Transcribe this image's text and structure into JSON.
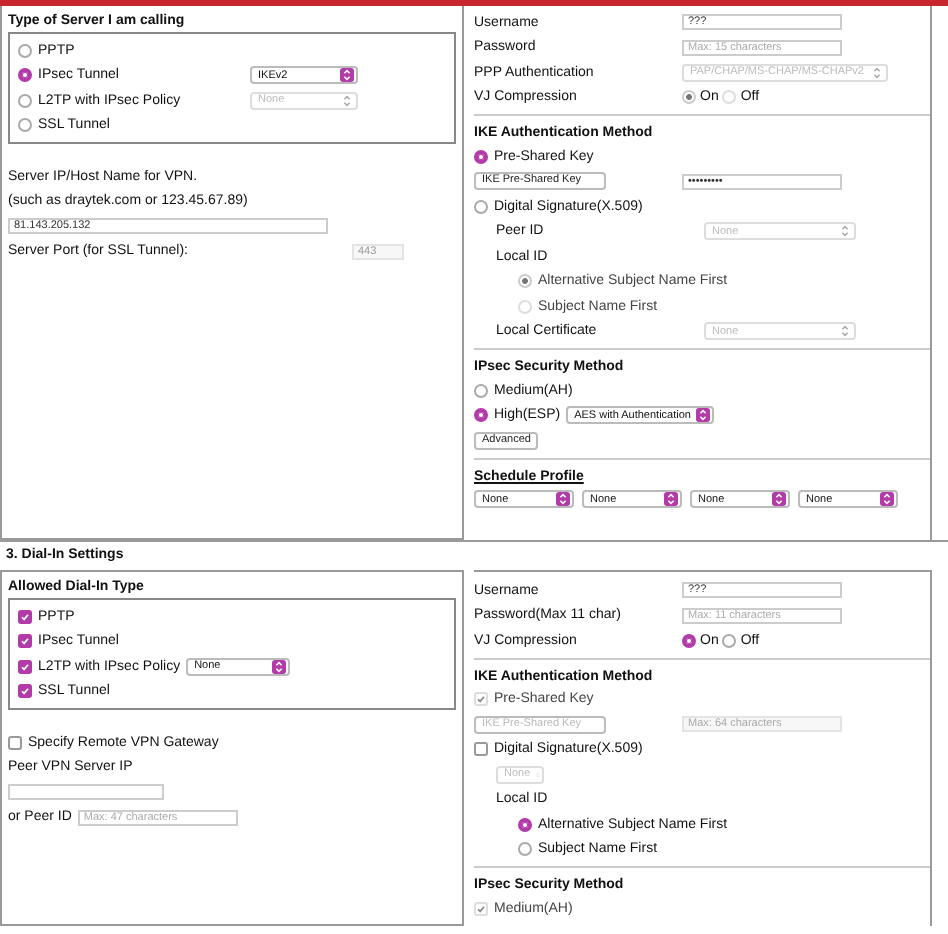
{
  "dial_out": {
    "server_type": {
      "title": "Type of Server I am calling",
      "items": [
        {
          "kind": "radio",
          "label": "PPTP",
          "selected": false
        },
        {
          "kind": "radio",
          "label": "IPsec Tunnel",
          "selected": true,
          "select": {
            "value": "IKEv2",
            "disabled": false
          }
        },
        {
          "kind": "radio",
          "label": "L2TP with IPsec Policy",
          "selected": false,
          "select": {
            "value": "None",
            "disabled": true
          }
        },
        {
          "kind": "radio",
          "label": "SSL Tunnel",
          "selected": false
        }
      ]
    },
    "server_items": [
      {
        "kind": "text",
        "label": "Server IP/Host Name for VPN."
      },
      {
        "kind": "text",
        "label": "(such as draytek.com or 123.45.67.89)"
      },
      {
        "kind": "field",
        "value": "81.143.205.132"
      },
      {
        "kind": "field",
        "label": "Server Port (for SSL Tunnel):",
        "value": "443",
        "disabled": true
      }
    ],
    "sections": [
      {
        "items": [
          {
            "kind": "field",
            "label": "Username",
            "value": "???"
          },
          {
            "kind": "field",
            "label": "Password",
            "placeholder": "Max: 15 characters"
          },
          {
            "kind": "select",
            "label": "PPP Authentication",
            "value": "PAP/CHAP/MS-CHAP/MS-CHAPv2",
            "disabled": true
          },
          {
            "kind": "options",
            "label": "VJ Compression",
            "disabled": true,
            "options": [
              {
                "label": "On",
                "selected": true
              },
              {
                "label": "Off",
                "selected": false
              }
            ]
          }
        ]
      },
      {
        "title": "IKE Authentication Method",
        "items": [
          {
            "kind": "radio",
            "label": "Pre-Shared Key",
            "selected": true
          },
          {
            "kind": "key",
            "button": {
              "label": "IKE Pre-Shared Key",
              "disabled": false
            },
            "field": {
              "value": "•••••••••"
            }
          },
          {
            "kind": "radio",
            "label": "Digital Signature(X.509)",
            "selected": false,
            "children": [
              {
                "kind": "select",
                "label": "Peer ID",
                "value": "None",
                "disabled": true
              },
              {
                "kind": "text",
                "label": "Local ID",
                "children": [
                  {
                    "kind": "radio",
                    "label": "Alternative Subject Name First",
                    "selected": true,
                    "disabled": true
                  },
                  {
                    "kind": "radio",
                    "label": "Subject Name First",
                    "selected": false,
                    "disabled": true
                  }
                ]
              },
              {
                "kind": "select",
                "label": "Local Certificate",
                "value": "None",
                "disabled": true
              }
            ]
          }
        ]
      },
      {
        "title": "IPsec Security Method",
        "items": [
          {
            "kind": "radio",
            "label": "Medium(AH)",
            "selected": false
          },
          {
            "kind": "radio",
            "label": "High(ESP)",
            "selected": true,
            "select": {
              "value": "AES with Authentication",
              "disabled": false
            }
          },
          {
            "kind": "button",
            "label": "Advanced"
          }
        ]
      },
      {
        "title": "Schedule Profile",
        "link": true,
        "items": [
          {
            "kind": "selects",
            "selects": [
              {
                "value": "None"
              },
              {
                "value": "None"
              },
              {
                "value": "None"
              },
              {
                "value": "None"
              }
            ]
          }
        ]
      }
    ]
  },
  "dial_in": {
    "heading": "3. Dial-In Settings",
    "allowed": {
      "title": "Allowed Dial-In Type",
      "items": [
        {
          "kind": "checkbox",
          "label": "PPTP",
          "checked": true
        },
        {
          "kind": "checkbox",
          "label": "IPsec Tunnel",
          "checked": true
        },
        {
          "kind": "checkbox",
          "label": "L2TP with IPsec Policy",
          "checked": true,
          "select": {
            "value": "None",
            "disabled": false
          }
        },
        {
          "kind": "checkbox",
          "label": "SSL Tunnel",
          "checked": true
        }
      ]
    },
    "items": [
      {
        "kind": "checkbox",
        "label": "Specify Remote VPN Gateway",
        "checked": false
      },
      {
        "kind": "text",
        "label": "Peer VPN Server IP"
      },
      {
        "kind": "field"
      },
      {
        "kind": "inline-field",
        "label": "or Peer ID",
        "placeholder": "Max: 47 characters"
      }
    ],
    "sections": [
      {
        "items": [
          {
            "kind": "field",
            "label": "Username",
            "value": "???"
          },
          {
            "kind": "field",
            "label": "Password(Max 11 char)",
            "placeholder": "Max: 11 characters"
          },
          {
            "kind": "options",
            "label": "VJ Compression",
            "disabled": false,
            "options": [
              {
                "label": "On",
                "selected": true
              },
              {
                "label": "Off",
                "selected": false
              }
            ]
          }
        ]
      },
      {
        "title": "IKE Authentication Method",
        "items": [
          {
            "kind": "checkbox",
            "label": "Pre-Shared Key",
            "checked": true,
            "disabled": true
          },
          {
            "kind": "key",
            "button": {
              "label": "IKE Pre-Shared Key",
              "disabled": true
            },
            "field": {
              "placeholder": "Max: 64 characters",
              "disabled": true
            }
          },
          {
            "kind": "checkbox",
            "label": "Digital Signature(X.509)",
            "checked": false,
            "children": [
              {
                "kind": "select",
                "value": "None",
                "disabled": true
              },
              {
                "kind": "text",
                "label": "Local ID",
                "children": [
                  {
                    "kind": "radio",
                    "label": "Alternative Subject Name First",
                    "selected": true
                  },
                  {
                    "kind": "radio",
                    "label": "Subject Name First",
                    "selected": false
                  }
                ]
              }
            ]
          }
        ]
      },
      {
        "title": "IPsec Security Method",
        "items": [
          {
            "kind": "checkbox",
            "label": "Medium(AH)",
            "checked": true,
            "disabled": true
          }
        ]
      }
    ]
  }
}
